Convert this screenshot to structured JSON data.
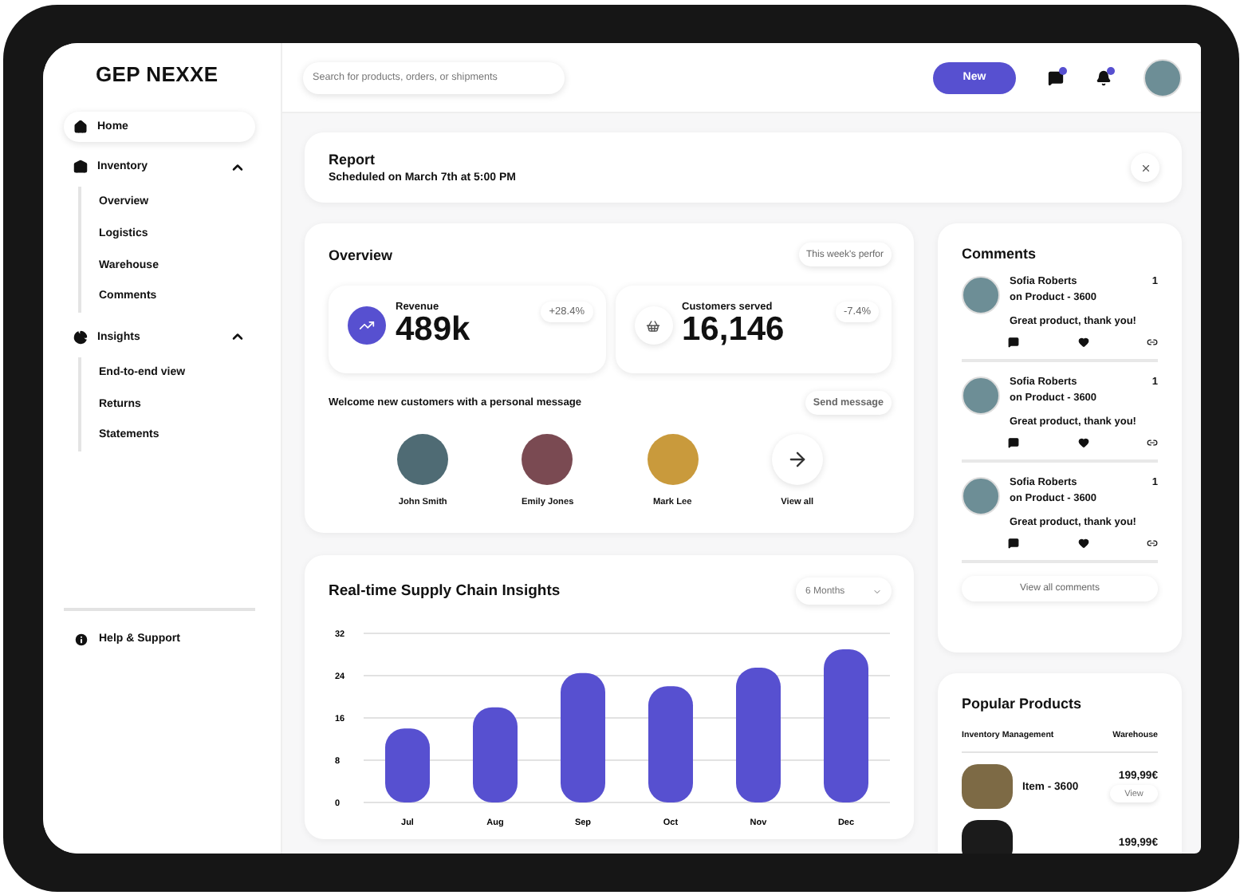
{
  "sidebar": {
    "logo": "GEP NEXXE",
    "items": [
      {
        "label": "Home",
        "selected": true
      },
      {
        "label": "Inventory",
        "selected": false,
        "expanded": true,
        "children": [
          {
            "label": "Overview"
          },
          {
            "label": "Logistics"
          },
          {
            "label": "Warehouse"
          },
          {
            "label": "Comments"
          }
        ]
      },
      {
        "label": "Insights",
        "selected": false,
        "expanded": true,
        "children": [
          {
            "label": "End-to-end view"
          },
          {
            "label": "Returns"
          },
          {
            "label": "Statements"
          }
        ]
      }
    ],
    "footer": {
      "label": "Help & Support"
    }
  },
  "topbar": {
    "search": {
      "placeholder": "Search for products, orders, or shipments"
    },
    "new_button": "New",
    "messages_unread": true,
    "notifications_unread": true
  },
  "report": {
    "title": "Report",
    "subtitle": "Scheduled on March 7th at 5:00 PM"
  },
  "overview": {
    "title": "Overview",
    "period_filter": "This week's perfor",
    "stats": [
      {
        "label": "Revenue",
        "value": "489k",
        "change": "+28.4%"
      },
      {
        "label": "Customers served",
        "value": "16,146",
        "change": "-7.4%"
      }
    ],
    "welcome": "Welcome new customers with a personal message",
    "send_button": "Send message",
    "customers": [
      {
        "name": "John Smith"
      },
      {
        "name": "Emily Jones"
      },
      {
        "name": "Mark Lee"
      }
    ],
    "view_all": "View all"
  },
  "insights": {
    "title": "Real-time Supply Chain Insights",
    "range": "6 Months",
    "chart_data": {
      "type": "bar",
      "categories": [
        "Jul",
        "Aug",
        "Sep",
        "Oct",
        "Nov",
        "Dec"
      ],
      "values": [
        14,
        18,
        24.5,
        22,
        25.5,
        29
      ],
      "ylim": [
        0,
        32
      ],
      "yticks": [
        0,
        8,
        16,
        24,
        32
      ],
      "grid": true
    }
  },
  "comments": {
    "title": "Comments",
    "items": [
      {
        "name": "Sofia Roberts",
        "count": "1",
        "product": "on Product - 3600",
        "text": "Great product, thank you!"
      },
      {
        "name": "Sofia Roberts",
        "count": "1",
        "product": "on Product - 3600",
        "text": "Great product, thank you!"
      },
      {
        "name": "Sofia Roberts",
        "count": "1",
        "product": "on Product - 3600",
        "text": "Great product, thank you!"
      }
    ],
    "view_all": "View all comments"
  },
  "popular_products": {
    "title": "Popular Products",
    "columns": [
      "Inventory Management",
      "Warehouse"
    ],
    "items": [
      {
        "name": "Item - 3600",
        "price": "199,99€",
        "action": "View"
      },
      {
        "price": "199,99€"
      }
    ]
  }
}
